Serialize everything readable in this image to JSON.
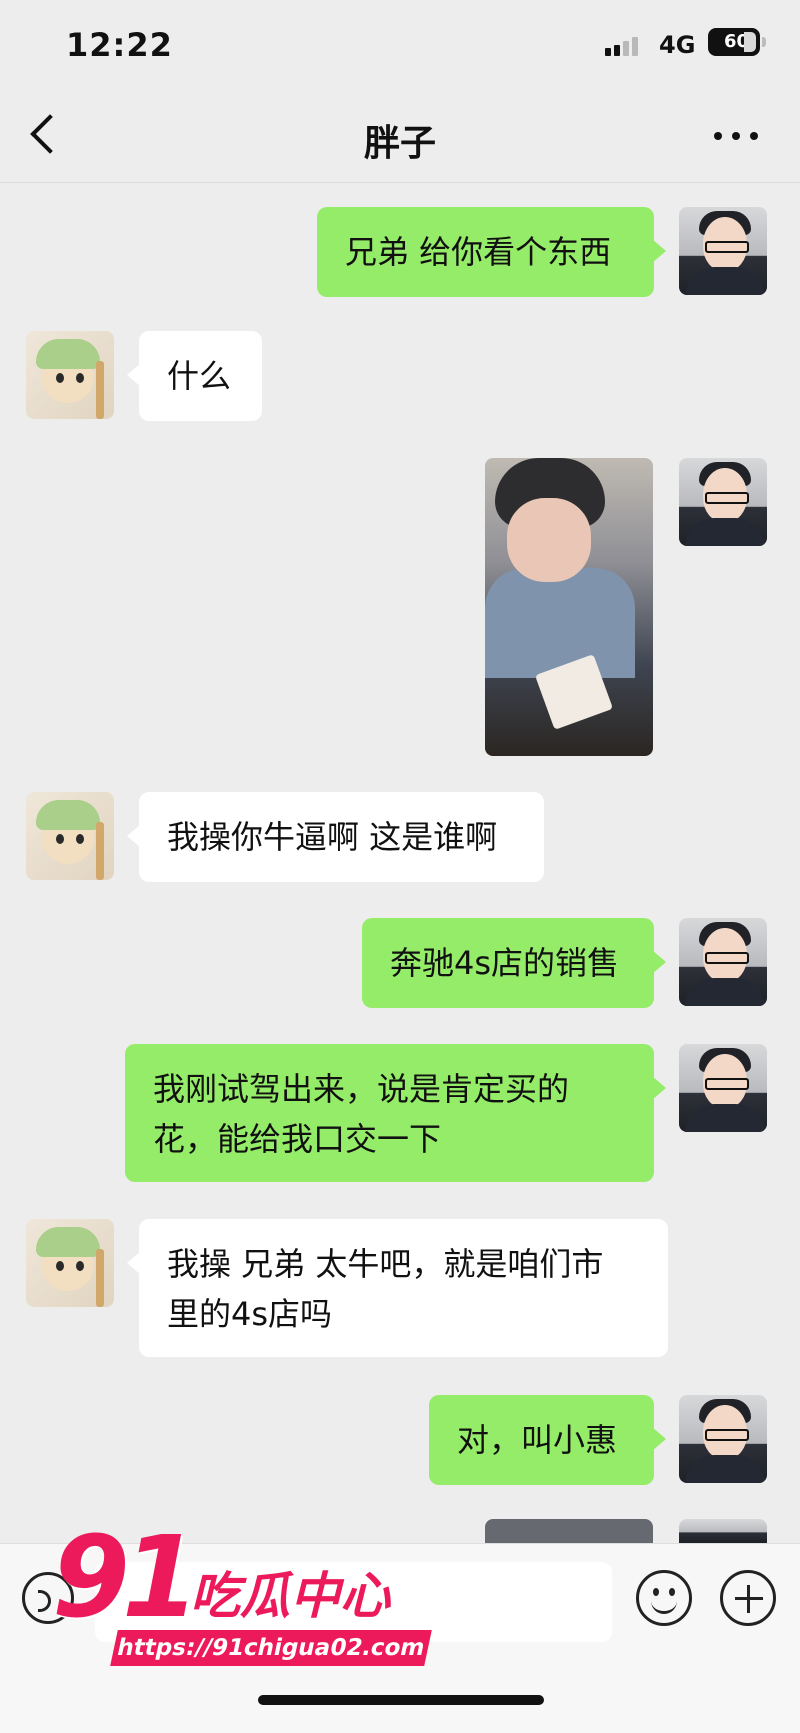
{
  "status_bar": {
    "time": "12:22",
    "network": "4G",
    "battery": "60"
  },
  "nav": {
    "title": "胖子"
  },
  "messages": [
    {
      "side": "out",
      "text": "兄弟 给你看个东西"
    },
    {
      "side": "in",
      "text": "什么"
    },
    {
      "side": "out",
      "type": "image"
    },
    {
      "side": "in",
      "text": "我操你牛逼啊 这是谁啊"
    },
    {
      "side": "out",
      "text": "奔驰4s店的销售"
    },
    {
      "side": "out",
      "lines": [
        "我刚试驾出来，说是肯定买的",
        "花，能给我口交一下"
      ]
    },
    {
      "side": "in",
      "lines": [
        "我操 兄弟 太牛吧，就是咱们市",
        "里的4s店吗"
      ]
    },
    {
      "side": "out",
      "text": "对，叫小惠"
    }
  ],
  "watermark": {
    "number": "91",
    "brand": "吃瓜中心",
    "url": "https://91chigua02.com"
  },
  "icons": {
    "back": "chevron-left-icon",
    "more": "more-dots-icon",
    "voice": "voice-icon",
    "emoji": "emoji-icon",
    "plus": "plus-icon"
  },
  "colors": {
    "outgoing_bubble": "#95ec69",
    "incoming_bubble": "#ffffff",
    "background": "#ededed",
    "watermark": "#ec1a5b"
  }
}
